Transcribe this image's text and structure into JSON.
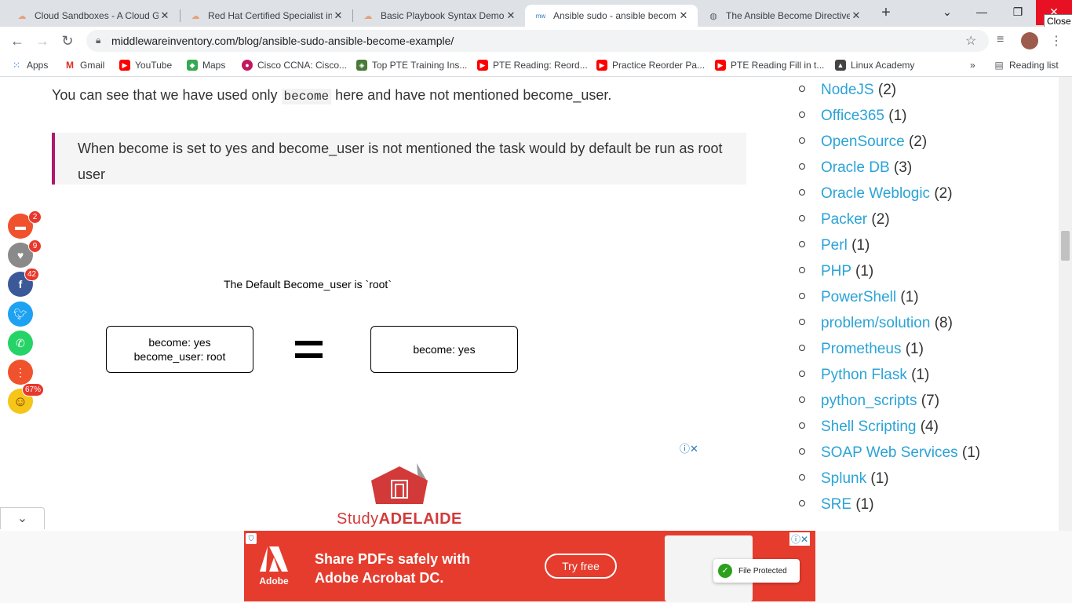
{
  "browser": {
    "tabs": [
      {
        "title": "Cloud Sandboxes - A Cloud G",
        "close": "✕"
      },
      {
        "title": "Red Hat Certified Specialist in",
        "close": "✕"
      },
      {
        "title": "Basic Playbook Syntax Demor",
        "close": "✕"
      },
      {
        "title": "Ansible sudo - ansible becom",
        "close": "✕"
      },
      {
        "title": "The Ansible Become Directive",
        "close": "✕"
      }
    ],
    "new_tab": "+",
    "tooltip": "Close",
    "url": "middlewareinventory.com/blog/ansible-sudo-ansible-become-example/",
    "bookmarks": [
      {
        "label": "Apps"
      },
      {
        "label": "Gmail"
      },
      {
        "label": "YouTube"
      },
      {
        "label": "Maps"
      },
      {
        "label": "Cisco CCNA: Cisco..."
      },
      {
        "label": "Top PTE Training Ins..."
      },
      {
        "label": "PTE Reading: Reord..."
      },
      {
        "label": "Practice Reorder Pa..."
      },
      {
        "label": "PTE Reading Fill in t..."
      },
      {
        "label": "Linux Academy"
      }
    ],
    "reading_list": "Reading list",
    "more": "»"
  },
  "article": {
    "para_before": "You can see that we have used only ",
    "para_code": "become",
    "para_after": " here and have not mentioned become_user.",
    "quote": "When become is set to yes and become_user is not mentioned the task would by default be run as root user",
    "diagram": {
      "title": "The Default Become_user is `root`",
      "left_line1": "become: yes",
      "left_line2": "become_user: root",
      "right": "become: yes"
    }
  },
  "share": {
    "comments_count": "2",
    "likes_count": "9",
    "facebook_count": "42",
    "reaction_percent": "67%"
  },
  "inline_ad": {
    "controls": "ⓘ✕",
    "brand_prefix": "Study",
    "brand_main": "ADELAIDE"
  },
  "sidebar": {
    "items": [
      {
        "label": "NodeJS",
        "count": "(2)"
      },
      {
        "label": "Office365",
        "count": "(1)"
      },
      {
        "label": "OpenSource",
        "count": "(2)"
      },
      {
        "label": "Oracle DB",
        "count": "(3)"
      },
      {
        "label": "Oracle Weblogic",
        "count": "(2)"
      },
      {
        "label": "Packer",
        "count": "(2)"
      },
      {
        "label": "Perl",
        "count": "(1)"
      },
      {
        "label": "PHP",
        "count": "(1)"
      },
      {
        "label": "PowerShell",
        "count": "(1)"
      },
      {
        "label": "problem/solution",
        "count": "(8)"
      },
      {
        "label": "Prometheus",
        "count": "(1)"
      },
      {
        "label": "Python Flask",
        "count": "(1)"
      },
      {
        "label": "python_scripts",
        "count": "(7)"
      },
      {
        "label": "Shell Scripting",
        "count": "(4)"
      },
      {
        "label": "SOAP Web Services",
        "count": "(1)"
      },
      {
        "label": "Splunk",
        "count": "(1)"
      },
      {
        "label": "SRE",
        "count": "(1)"
      }
    ]
  },
  "bottom_ad": {
    "brand": "Adobe",
    "headline1": "Share PDFs safely with",
    "headline2": "Adobe Acrobat DC.",
    "cta": "Try free",
    "badge": "File Protected",
    "controls": "ⓘ✕"
  }
}
